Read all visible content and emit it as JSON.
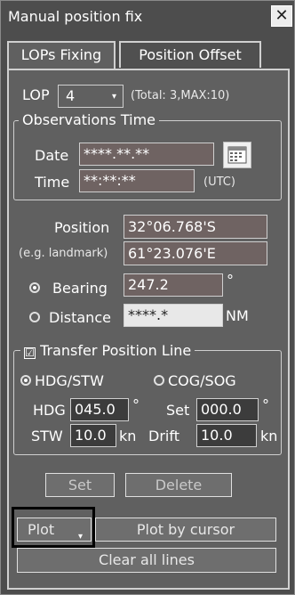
{
  "window": {
    "title": "Manual position fix",
    "close_glyph": "✕"
  },
  "tabs": [
    {
      "label": "LOPs Fixing",
      "active": true
    },
    {
      "label": "Position Offset",
      "active": false
    }
  ],
  "lop": {
    "label": "LOP",
    "value": "4",
    "total_text": "(Total:  3,MAX:10)"
  },
  "observations": {
    "legend": "Observations Time",
    "date_label": "Date",
    "date_value": "****.**.**",
    "time_label": "Time",
    "time_value": "**:**:**",
    "time_unit": "(UTC)",
    "calendar_icon": "calendar-icon"
  },
  "position": {
    "label": "Position",
    "lat": "32°06.768'S",
    "example_label": "(e.g. landmark)",
    "lon": "61°23.076'E"
  },
  "bearing": {
    "label": "Bearing",
    "value": "247.2",
    "unit": "°",
    "selected": true
  },
  "distance": {
    "label": "Distance",
    "value": "****.*",
    "unit": "NM",
    "selected": false
  },
  "transfer": {
    "legend": "Transfer Position Line",
    "checked": true,
    "check_glyph": "☑",
    "hdg_stw_label": "HDG/STW",
    "cog_sog_label": "COG/SOG",
    "hdg_label": "HDG",
    "hdg_value": "045.0",
    "hdg_unit": "°",
    "stw_label": "STW",
    "stw_value": "10.0",
    "stw_unit": "kn",
    "set_label": "Set",
    "set_value": "000.0",
    "set_unit": "°",
    "drift_label": "Drift",
    "drift_value": "10.0",
    "drift_unit": "kn"
  },
  "actions": {
    "set_label": "Set",
    "delete_label": "Delete"
  },
  "plot": {
    "plot_label": "Plot",
    "plot_by_cursor_label": "Plot by cursor",
    "clear_all_label": "Clear all lines"
  },
  "colors": {
    "window_bg": "#4d4d4d",
    "panel_bg": "#606060",
    "field_bg": "#6f6362",
    "highlight": "#000000"
  }
}
